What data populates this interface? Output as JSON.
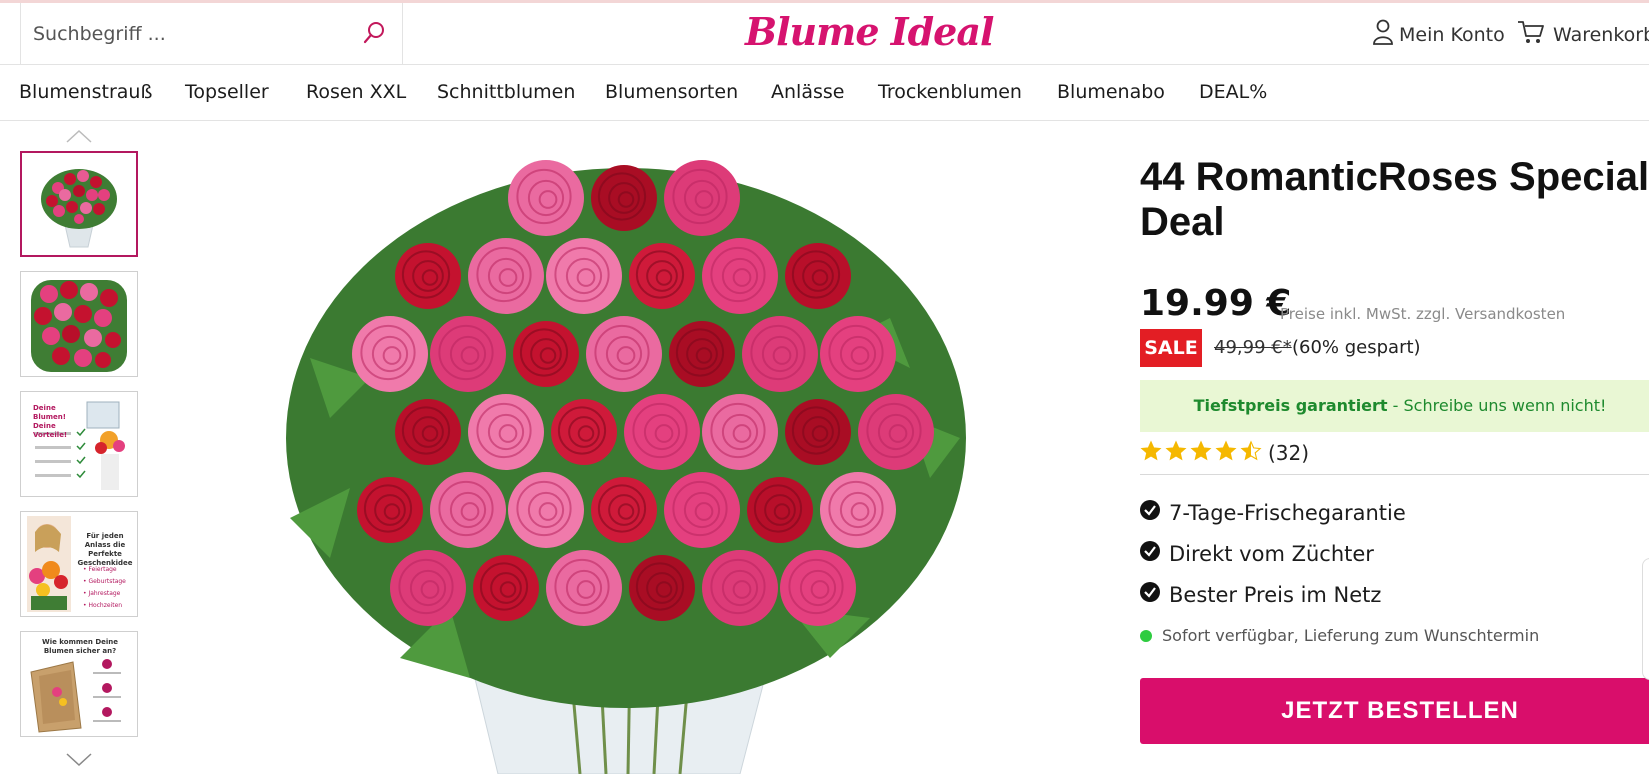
{
  "header": {
    "search_placeholder": "Suchbegriff ...",
    "logo_text": "Blume Ideal",
    "account_label": "Mein Konto",
    "cart_label": "Warenkorb"
  },
  "nav": {
    "items": [
      "Blumenstrauß",
      "Topseller",
      "Rosen XXL",
      "Schnittblumen",
      "Blumensorten",
      "Anlässe",
      "Trockenblumen",
      "Blumenabo",
      "DEAL%"
    ]
  },
  "gallery": {
    "thumb3_title": "Deine Blumen! Deine Vorteile!",
    "thumb4_title": "Für jeden Anlass die Perfekte Geschenkidee",
    "thumb4_items": [
      "• Feiertage",
      "• Geburtstage",
      "• Jahrestage",
      "• Hochzeiten"
    ],
    "thumb5_title": "Wie kommen Deine Blumen sicher an?"
  },
  "product": {
    "title": "44 RomanticRoses Special Deal",
    "price": "19.99 €",
    "price_note": "Preise inkl. MwSt. zzgl. Versandkosten",
    "sale_badge": "SALE",
    "old_price": "49,99 €*",
    "saved": "(60% gespart)",
    "guarantee_bold": "Tiefstpreis garantiert",
    "guarantee_rest": " - Schreibe uns wenn nicht!",
    "rating_value": 4.5,
    "rating_count": "(32)",
    "usps": [
      "7-Tage-Frischegarantie",
      "Direkt vom Züchter",
      "Bester Preis im Netz"
    ],
    "availability": "Sofort verfügbar, Lieferung zum Wunschtermin",
    "order_button": "JETZT BESTELLEN"
  },
  "colors": {
    "brand": "#d6136f",
    "order_button": "#d90e6b",
    "sale": "#e31e24",
    "guarantee_bg": "#e9f7d4",
    "guarantee_text": "#1e8a2e",
    "star": "#f5b800",
    "available": "#2ecc40"
  }
}
